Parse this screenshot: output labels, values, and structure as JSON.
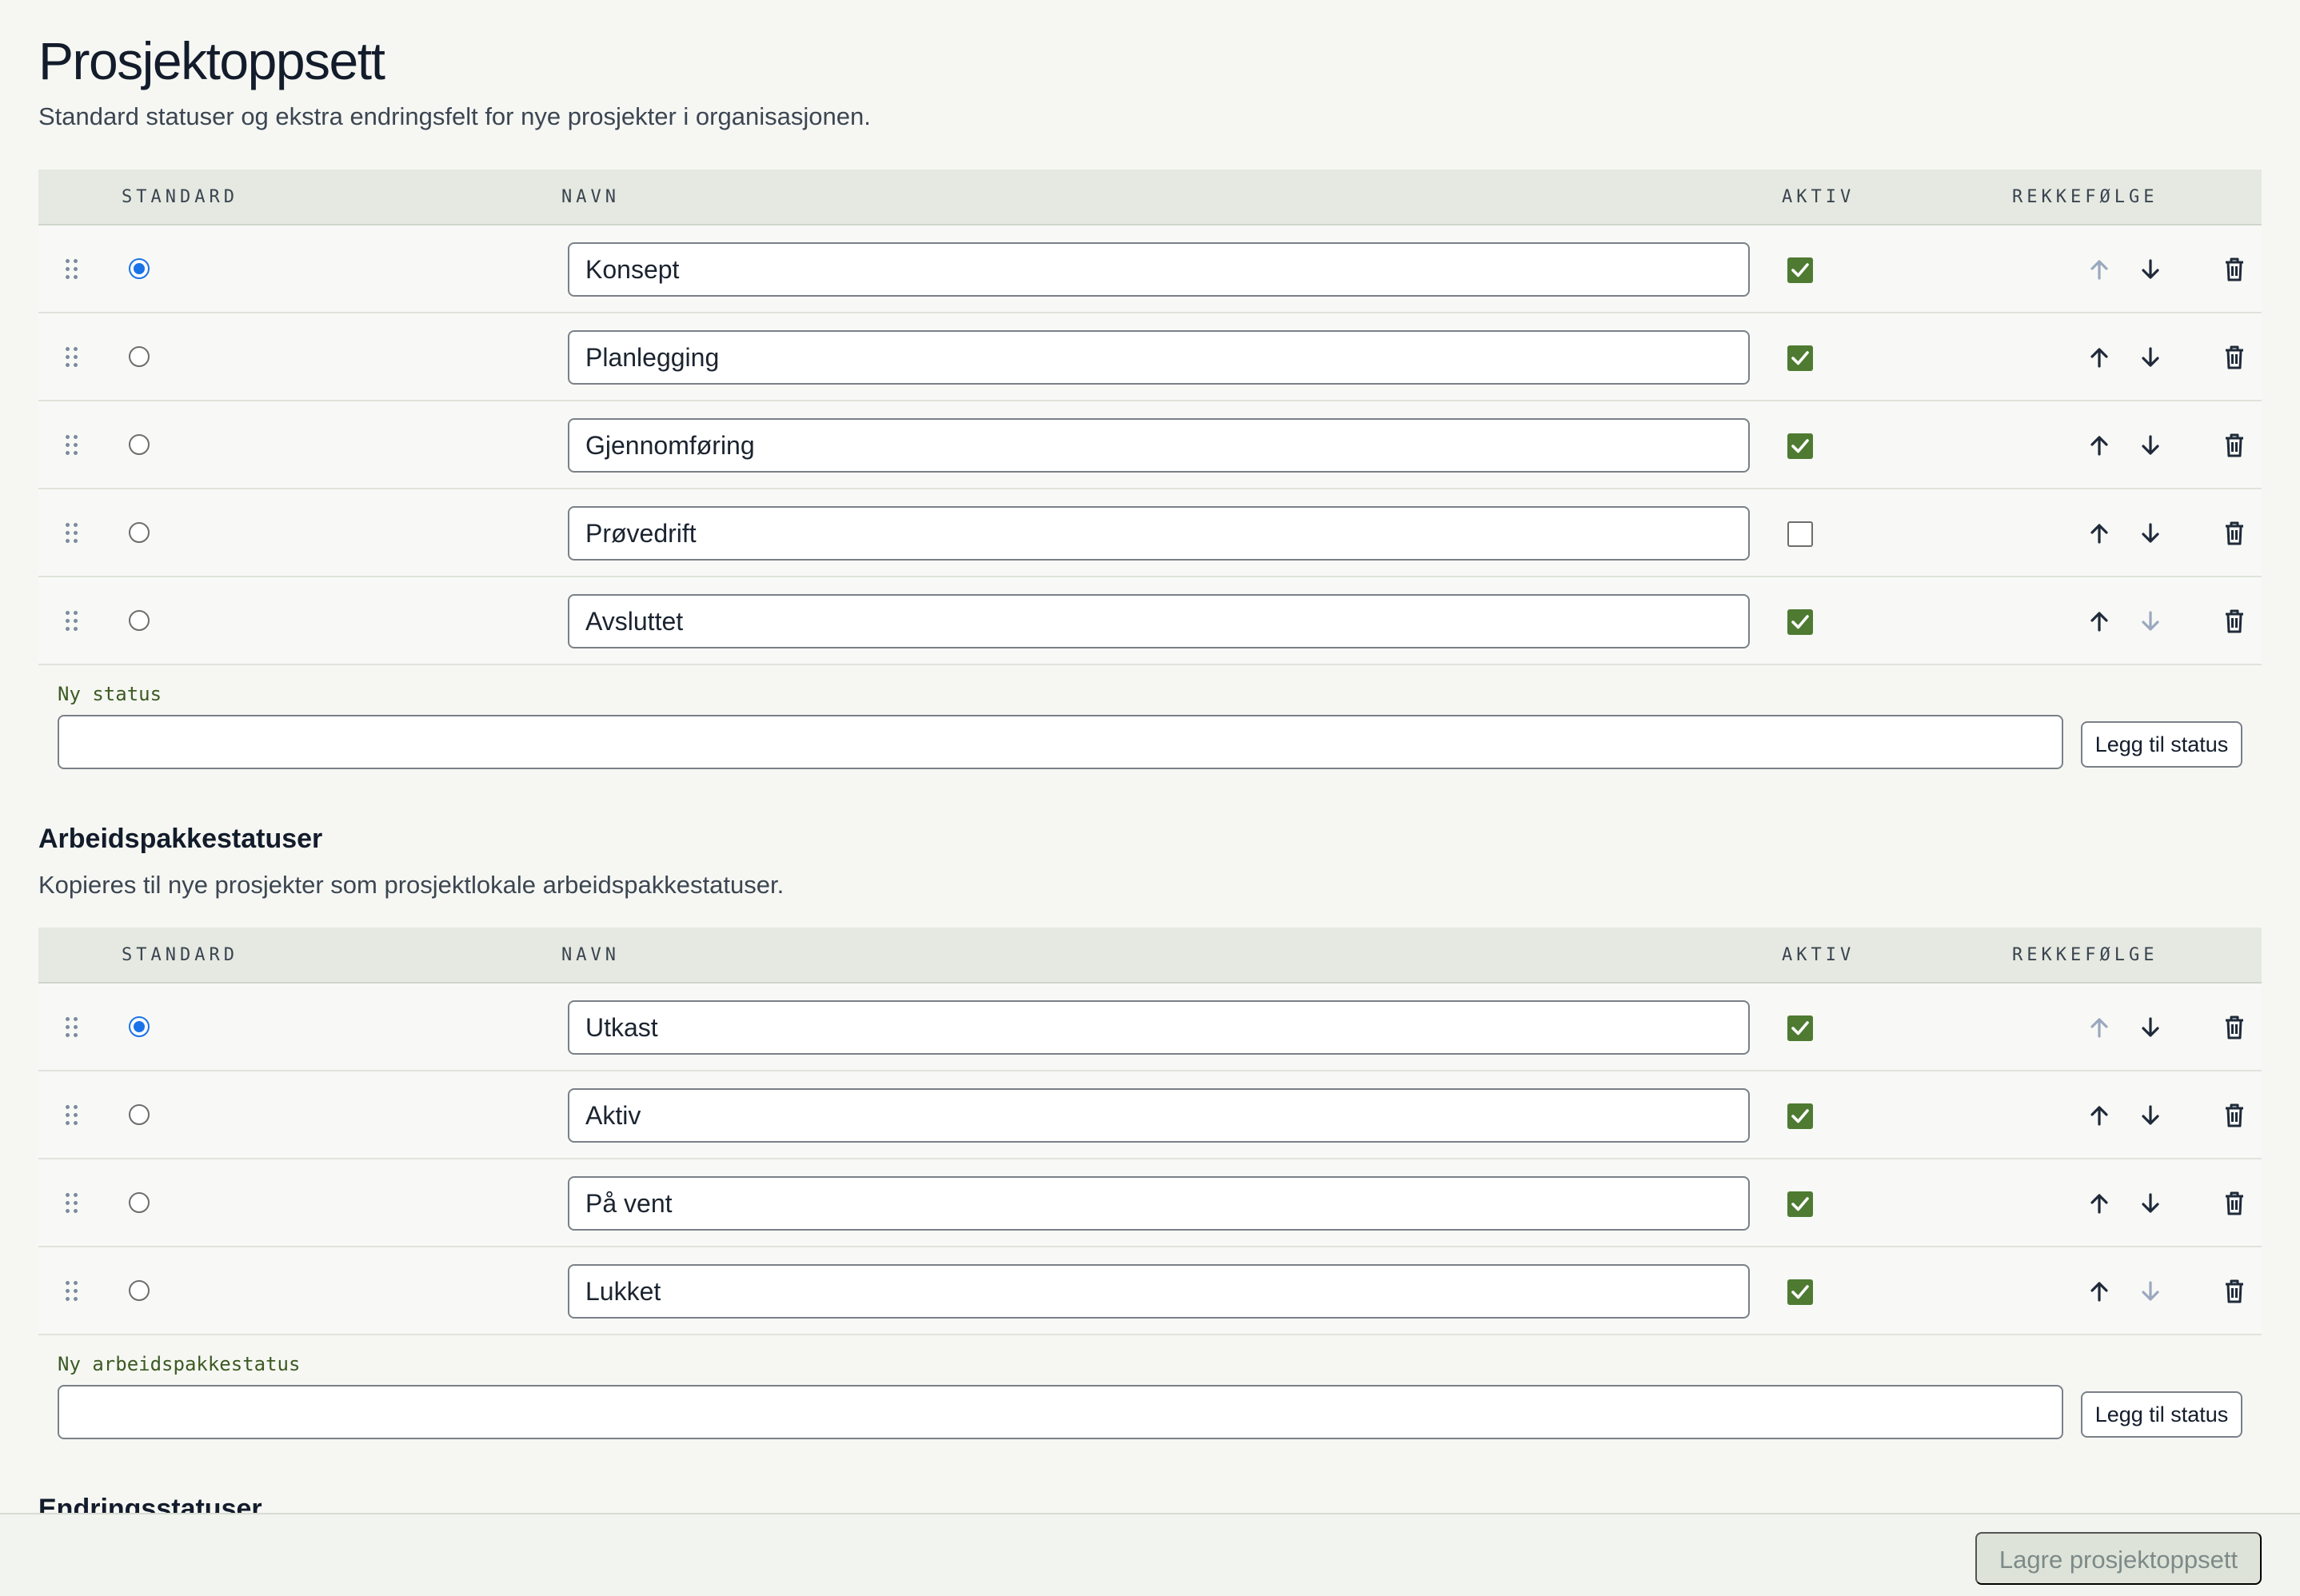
{
  "page": {
    "title": "Prosjektoppsett",
    "subtitle": "Standard statuser og ekstra endringsfelt for nye prosjekter i organisasjonen."
  },
  "columns": {
    "standard": "STANDARD",
    "navn": "NAVN",
    "aktiv": "AKTIV",
    "rekkefolge": "REKKEFØLGE"
  },
  "project_statuses": {
    "rows": [
      {
        "name": "Konsept",
        "default": true,
        "active": true,
        "up_enabled": false,
        "down_enabled": true
      },
      {
        "name": "Planlegging",
        "default": false,
        "active": true,
        "up_enabled": true,
        "down_enabled": true
      },
      {
        "name": "Gjennomføring",
        "default": false,
        "active": true,
        "up_enabled": true,
        "down_enabled": true
      },
      {
        "name": "Prøvedrift",
        "default": false,
        "active": false,
        "up_enabled": true,
        "down_enabled": true
      },
      {
        "name": "Avsluttet",
        "default": false,
        "active": true,
        "up_enabled": true,
        "down_enabled": false
      }
    ],
    "new_label": "Ny status",
    "new_value": "",
    "add_button": "Legg til status"
  },
  "work_package_statuses": {
    "title": "Arbeidspakkestatuser",
    "subtitle": "Kopieres til nye prosjekter som prosjektlokale arbeidspakkestatuser.",
    "rows": [
      {
        "name": "Utkast",
        "default": true,
        "active": true,
        "up_enabled": false,
        "down_enabled": true
      },
      {
        "name": "Aktiv",
        "default": false,
        "active": true,
        "up_enabled": true,
        "down_enabled": true
      },
      {
        "name": "På vent",
        "default": false,
        "active": true,
        "up_enabled": true,
        "down_enabled": true
      },
      {
        "name": "Lukket",
        "default": false,
        "active": true,
        "up_enabled": true,
        "down_enabled": false
      }
    ],
    "new_label": "Ny arbeidspakkestatus",
    "new_value": "",
    "add_button": "Legg til status"
  },
  "change_statuses": {
    "title": "Endringsstatuser"
  },
  "footer": {
    "save_button": "Lagre prosjektoppsett"
  },
  "colors": {
    "accent_radio": "#1a73e8",
    "checkbox_on": "#4e7a32",
    "header_bg": "#e5e9e1",
    "page_bg": "#f6f7f3"
  }
}
